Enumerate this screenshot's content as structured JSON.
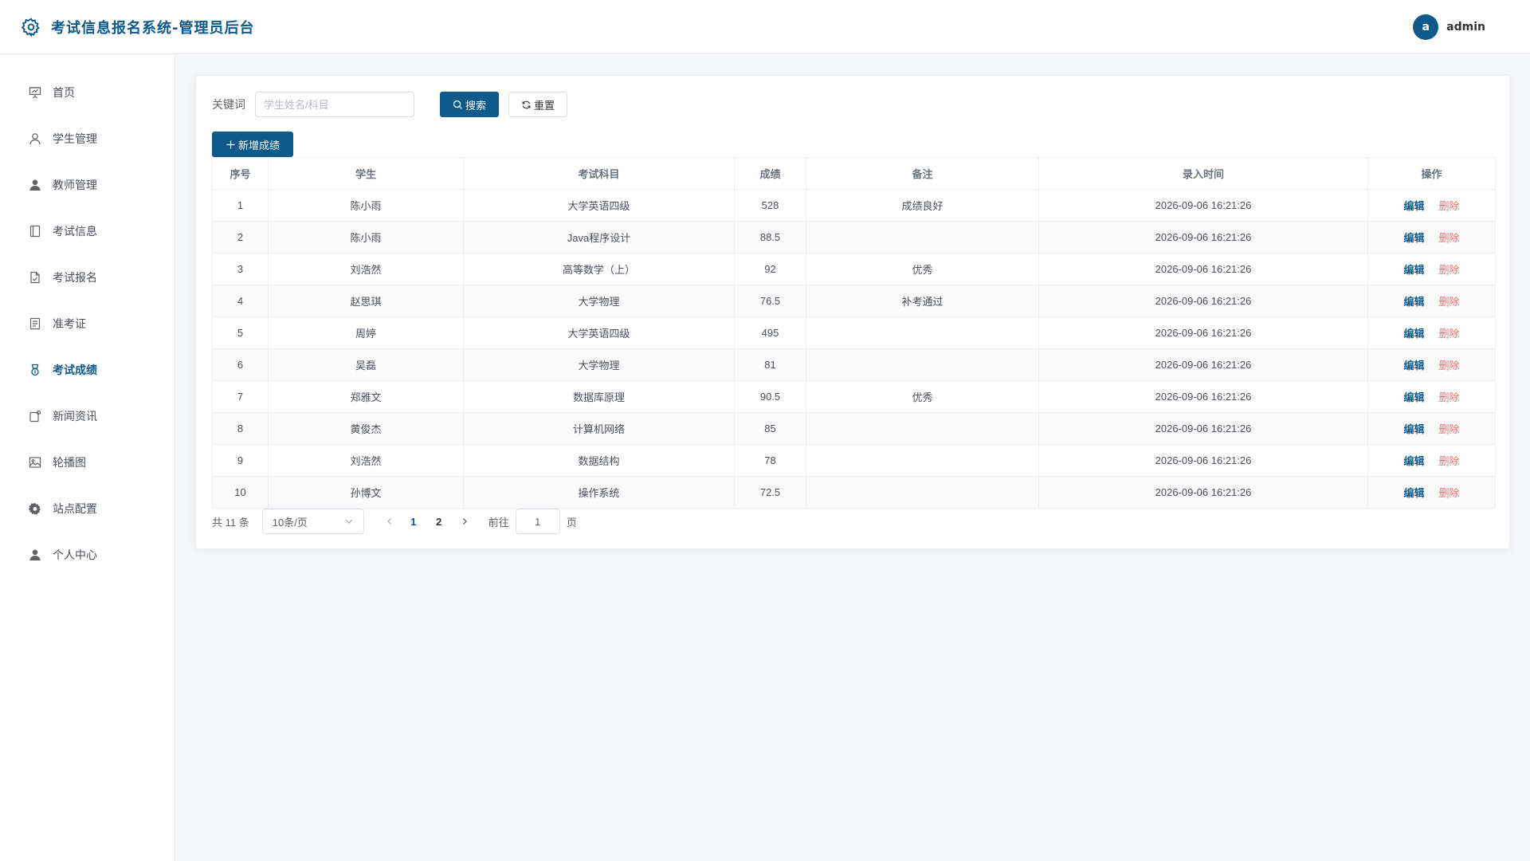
{
  "header": {
    "title": "考试信息报名系统-管理员后台",
    "avatar_letter": "a",
    "username": "admin"
  },
  "sidebar": {
    "items": [
      {
        "label": "首页",
        "icon": "presentation-icon"
      },
      {
        "label": "学生管理",
        "icon": "user-outline-icon"
      },
      {
        "label": "教师管理",
        "icon": "user-filled-icon"
      },
      {
        "label": "考试信息",
        "icon": "notebook-icon"
      },
      {
        "label": "考试报名",
        "icon": "document-icon"
      },
      {
        "label": "准考证",
        "icon": "tickets-icon"
      },
      {
        "label": "考试成绩",
        "icon": "medal-icon",
        "active": true
      },
      {
        "label": "新闻资讯",
        "icon": "news-icon"
      },
      {
        "label": "轮播图",
        "icon": "picture-icon"
      },
      {
        "label": "站点配置",
        "icon": "setting-icon"
      },
      {
        "label": "个人中心",
        "icon": "user-filled-icon"
      }
    ]
  },
  "search": {
    "label": "关键词",
    "placeholder": "学生姓名/科目",
    "value": "",
    "search_button": "搜索",
    "reset_button": "重置"
  },
  "toolbar": {
    "add_button": "新增成绩"
  },
  "table": {
    "columns": [
      "序号",
      "学生",
      "考试科目",
      "成绩",
      "备注",
      "录入时间",
      "操作"
    ],
    "rows": [
      {
        "no": "1",
        "student": "陈小雨",
        "subject": "大学英语四级",
        "score": "528",
        "remark": "成绩良好",
        "time": "2026-09-06 16:21:26"
      },
      {
        "no": "2",
        "student": "陈小雨",
        "subject": "Java程序设计",
        "score": "88.5",
        "remark": "",
        "time": "2026-09-06 16:21:26"
      },
      {
        "no": "3",
        "student": "刘浩然",
        "subject": "高等数学（上）",
        "score": "92",
        "remark": "优秀",
        "time": "2026-09-06 16:21:26"
      },
      {
        "no": "4",
        "student": "赵思琪",
        "subject": "大学物理",
        "score": "76.5",
        "remark": "补考通过",
        "time": "2026-09-06 16:21:26"
      },
      {
        "no": "5",
        "student": "周婷",
        "subject": "大学英语四级",
        "score": "495",
        "remark": "",
        "time": "2026-09-06 16:21:26"
      },
      {
        "no": "6",
        "student": "吴磊",
        "subject": "大学物理",
        "score": "81",
        "remark": "",
        "time": "2026-09-06 16:21:26"
      },
      {
        "no": "7",
        "student": "郑雅文",
        "subject": "数据库原理",
        "score": "90.5",
        "remark": "优秀",
        "time": "2026-09-06 16:21:26"
      },
      {
        "no": "8",
        "student": "黄俊杰",
        "subject": "计算机网络",
        "score": "85",
        "remark": "",
        "time": "2026-09-06 16:21:26"
      },
      {
        "no": "9",
        "student": "刘浩然",
        "subject": "数据结构",
        "score": "78",
        "remark": "",
        "time": "2026-09-06 16:21:26"
      },
      {
        "no": "10",
        "student": "孙博文",
        "subject": "操作系统",
        "score": "72.5",
        "remark": "",
        "time": "2026-09-06 16:21:26"
      }
    ],
    "edit_label": "编辑",
    "delete_label": "删除"
  },
  "pagination": {
    "total_text": "共 11 条",
    "page_size": "10条/页",
    "pages": [
      "1",
      "2"
    ],
    "current_page": "1",
    "goto_label": "前往",
    "goto_value": "1",
    "goto_suffix": "页"
  },
  "colors": {
    "primary": "#0e5a8a",
    "danger": "#f56c6c"
  }
}
